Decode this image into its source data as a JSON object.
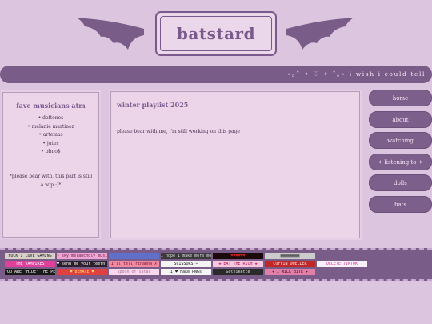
{
  "site": {
    "title": "batstard",
    "marquee": "⋆｡˚ ✧ ♡ ✧ ˚｡⋆ i wish i could tell"
  },
  "left_panel": {
    "title": "fave musicians atm",
    "musicians": [
      "• deftones",
      "• melanie martinez",
      "• artemas",
      "• jutes",
      "• bbno$"
    ],
    "note": "*please bear with, this part is still a wip :)*"
  },
  "main": {
    "title": "winter playlist 2025",
    "text": "please bear with me, i'm still working on this page"
  },
  "nav": [
    {
      "label": "home"
    },
    {
      "label": "about"
    },
    {
      "label": "watching"
    },
    {
      "label": "✧ listening to ✧"
    },
    {
      "label": "dolls"
    },
    {
      "label": "bats"
    }
  ],
  "blinkies": [
    {
      "text": "FUCK I LOVE GAMING",
      "bg": "#d8d0c8",
      "fg": "#222222"
    },
    {
      "text": "♡ sky melancholy music",
      "bg": "#f0a6d2",
      "fg": "#6a1a4a"
    },
    {
      "text": "",
      "bg": "#6070c8",
      "fg": "#ffffff"
    },
    {
      "text": "I hope I make more money than you",
      "bg": "#3a3a3a",
      "fg": "#dddddd"
    },
    {
      "text": "♥♥♥♥♥♥",
      "bg": "#1a0a0a",
      "fg": "#d02020"
    },
    {
      "text": "▦▦▦▦▦▦▦▦",
      "bg": "#cccccc",
      "fg": "#444444"
    },
    {
      "text": "THE VAMPIRES",
      "bg": "#e0409a",
      "fg": "#ffffff"
    },
    {
      "text": "♥ send me your teeth ♥",
      "bg": "#2a1f2a",
      "fg": "#ffffff"
    },
    {
      "text": "I'll tell rihanna ✗",
      "bg": "#f08aa0",
      "fg": "#7a1030"
    },
    {
      "text": "SCISSORS ✂",
      "bg": "#f4f4f4",
      "fg": "#222222"
    },
    {
      "text": "✚ EAT THE RICH ✚",
      "bg": "#f9c8e0",
      "fg": "#b0104a"
    },
    {
      "text": "COFFIN DWELLER",
      "bg": "#c02828",
      "fg": "#ffe0e0"
    },
    {
      "text": "DELETE TIKTOK",
      "bg": "#f8f0f8",
      "fg": "#e040a0"
    },
    {
      "text": "YOU ARE \"HIDE\" THE PERSON",
      "bg": "#1a1a1a",
      "fg": "#ffffff"
    },
    {
      "text": "♥ BEHAVE ♥",
      "bg": "#e04040",
      "fg": "#ffe060"
    },
    {
      "text": "spoon of satan",
      "bg": "#f7d8ec",
      "fg": "#b070a0"
    },
    {
      "text": "I ♥ Fake PNGs",
      "bg": "#f4f4f4",
      "fg": "#222222"
    },
    {
      "text": "Gothikette",
      "bg": "#2a2a2a",
      "fg": "#dddddd"
    },
    {
      "text": "✦ I WILL BITE ✦",
      "bg": "#e080a8",
      "fg": "#5a0a2a"
    }
  ]
}
